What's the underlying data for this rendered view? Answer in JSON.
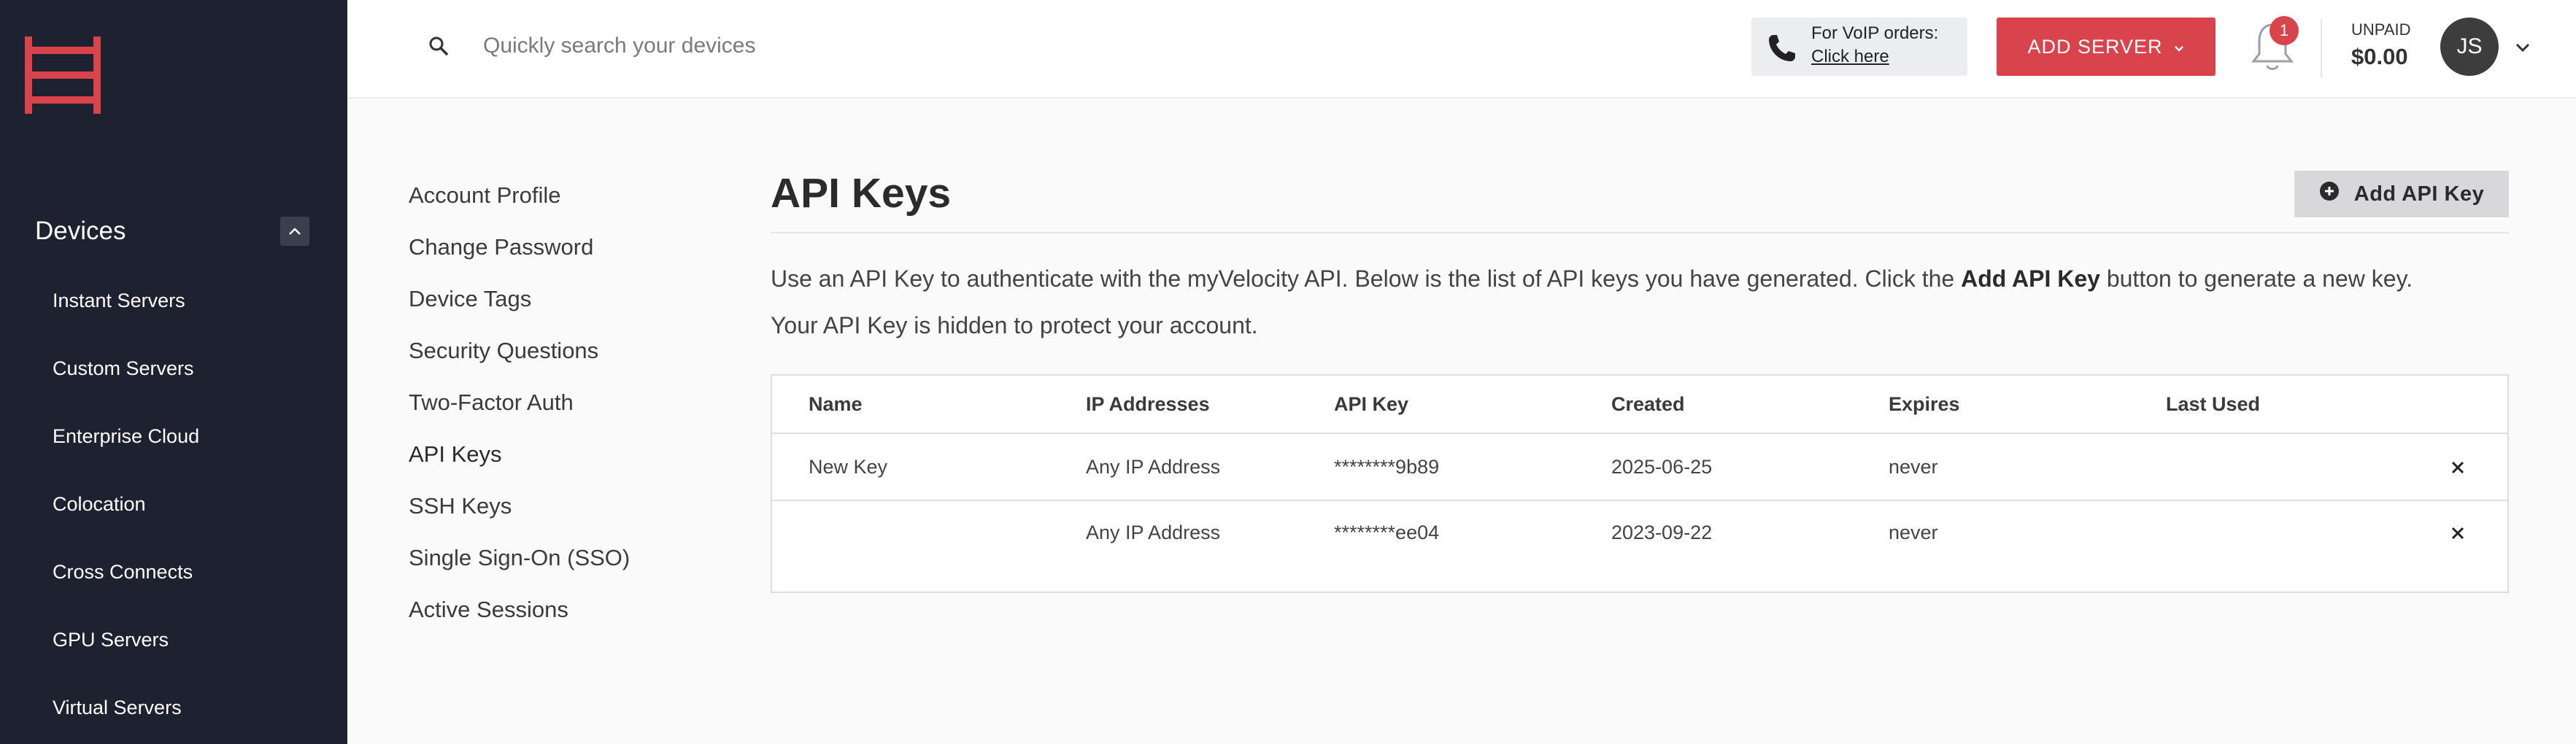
{
  "brand": {
    "accent": "#d9434b",
    "sidebar_bg": "#1d2130"
  },
  "sidebar": {
    "section_title": "Devices",
    "collapse_icon": "chevron-up-icon",
    "items": [
      {
        "label": "Instant Servers"
      },
      {
        "label": "Custom Servers"
      },
      {
        "label": "Enterprise Cloud"
      },
      {
        "label": "Colocation"
      },
      {
        "label": "Cross Connects"
      },
      {
        "label": "GPU Servers"
      },
      {
        "label": "Virtual Servers"
      }
    ]
  },
  "topbar": {
    "search_placeholder": "Quickly search your devices",
    "voip_label": "For VoIP orders:",
    "voip_link": "Click here",
    "add_server_label": "ADD SERVER",
    "notifications_count": "1",
    "billing_status": "UNPAID",
    "billing_amount": "$0.00",
    "user_initials": "JS"
  },
  "settings_nav": {
    "items": [
      {
        "label": "Account Profile"
      },
      {
        "label": "Change Password"
      },
      {
        "label": "Device Tags"
      },
      {
        "label": "Security Questions"
      },
      {
        "label": "Two-Factor Auth"
      },
      {
        "label": "API Keys"
      },
      {
        "label": "SSH Keys"
      },
      {
        "label": "Single Sign-On (SSO)"
      },
      {
        "label": "Active Sessions"
      }
    ],
    "active": "API Keys"
  },
  "main": {
    "title": "API Keys",
    "add_button_label": "Add API Key",
    "description_part1": "Use an API Key to authenticate with the myVelocity API. Below is the list of API keys you have generated. Click the ",
    "description_bold": "Add API Key",
    "description_part2": " button to generate a new key.",
    "description_line2": "Your API Key is hidden to protect your account.",
    "table": {
      "columns": [
        "Name",
        "IP Addresses",
        "API Key",
        "Created",
        "Expires",
        "Last Used"
      ],
      "rows": [
        {
          "name": "New Key",
          "ip": "Any IP Address",
          "key": "********9b89",
          "created": "2025-06-25",
          "expires": "never",
          "last_used": ""
        },
        {
          "name": "",
          "ip": "Any IP Address",
          "key": "********ee04",
          "created": "2023-09-22",
          "expires": "never",
          "last_used": ""
        }
      ]
    }
  }
}
